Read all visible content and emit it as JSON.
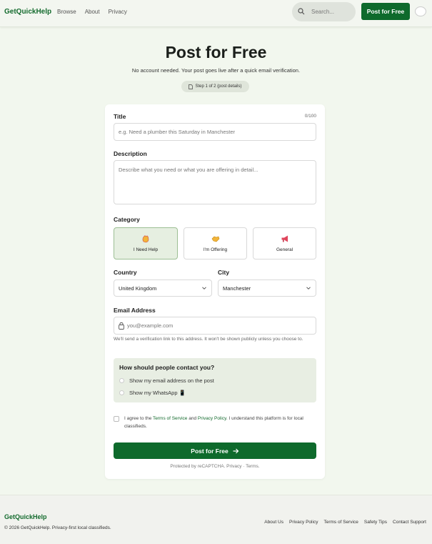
{
  "header": {
    "logo": "GetQuickHelp",
    "nav": [
      "Browse",
      "About",
      "Privacy"
    ],
    "search_placeholder": "Search...",
    "cta_label": "Post for Free"
  },
  "hero": {
    "title": "Post for Free",
    "subtitle": "No account needed. Your post goes live after a quick email verification.",
    "step": "Step 1 of 2 (post details)"
  },
  "form": {
    "title_label": "Title",
    "title_counter": "0/100",
    "title_placeholder": "e.g. Need a plumber this Saturday in Manchester",
    "description_label": "Description",
    "description_placeholder": "Describe what you need or what you are offering in detail...",
    "category_label": "Category",
    "categories": [
      {
        "label": "I Need Help",
        "icon": "waving-hand-icon",
        "selected": true
      },
      {
        "label": "I'm Offering",
        "icon": "handshake-icon",
        "selected": false
      },
      {
        "label": "General",
        "icon": "megaphone-icon",
        "selected": false
      }
    ],
    "country_label": "Country",
    "country_value": "United Kingdom",
    "city_label": "City",
    "city_value": "Manchester",
    "email_label": "Email Address",
    "email_placeholder": "you@example.com",
    "email_hint": "We'll send a verification link to this address. It won't be shown publicly unless you choose to.",
    "contact_title": "How should people contact you?",
    "contact_options": [
      "Show my email address on the post",
      "Show my WhatsApp 📱"
    ],
    "agree_prefix": "I agree to the ",
    "agree_tos": "Terms of Service",
    "agree_and": " and ",
    "agree_privacy": "Privacy Policy",
    "agree_suffix": ". I understand this platform is for local classifieds.",
    "submit_label": "Post for Free",
    "recaptcha": "Protected by reCAPTCHA. Privacy · Terms."
  },
  "footer": {
    "logo": "GetQuickHelp",
    "copyright": "© 2026 GetQuickHelp. Privacy-first local classifieds.",
    "links": [
      "About Us",
      "Privacy Policy",
      "Terms of Service",
      "Safety Tips",
      "Contact Support"
    ]
  },
  "colors": {
    "brand": "#0e6a2c",
    "background": "#f2f7ee",
    "selected_category": "#e6efe1"
  }
}
